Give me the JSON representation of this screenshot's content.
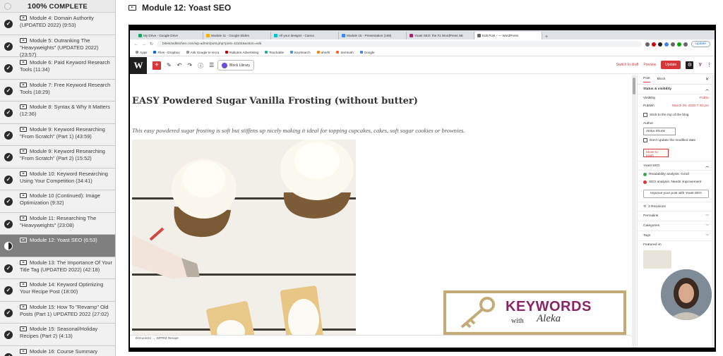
{
  "sidebar": {
    "progress_pct": "100%",
    "progress_label": "COMPLETE",
    "lessons": [
      {
        "title": "Module 4: Domain Authority (UPDATED 2022) (9:53)"
      },
      {
        "title": "Module 5: Outranking The \"Heavyweights\" (UPDATED 2022) (23:57)"
      },
      {
        "title": "Module 6: Paid Keyword Research Tools (11:34)"
      },
      {
        "title": "Module 7: Free Keyword Research Tools (18:29)"
      },
      {
        "title": "Module 8: Syntax & Why It Matters (12:36)"
      },
      {
        "title": "Module 9: Keyword Researching \"From Scratch\" (Part 1) (43:59)"
      },
      {
        "title": "Module 9: Keyword Researching \"From Scratch\" (Part 2) (15:52)"
      },
      {
        "title": "Module 10: Keyword Researching Using Your Competition (34:41)"
      },
      {
        "title": "Module 10 (Continued): Image Optimization (9:32)"
      },
      {
        "title": "Module 11: Researching The \"Heavyweights\" (23:08)"
      },
      {
        "title": "Module 12: Yoast SEO (6:53)"
      },
      {
        "title": "Module 13: The Importance Of Your Title Tag (UPDATED 2022) (42:18)"
      },
      {
        "title": "Module 14: Keyword Optimizing Your Recipe Post (18:00)"
      },
      {
        "title": "Module 15: How To \"Revamp\" Old Posts (Part 1) UPDATED 2022 (27:02)"
      },
      {
        "title": "Module 15: Seasonal/Holiday Recipes (Part 2) (4:13)"
      },
      {
        "title": "Module 16: Course Summary (UPDATED 2022) (5:40)"
      }
    ]
  },
  "header": {
    "title": "Module 12: Yoast SEO"
  },
  "browser": {
    "tabs": [
      "My Drive - Google Drive",
      "Module 11 - Google Slides",
      "All your designs - Canva",
      "Module 15 - Presentation (169)",
      "Yoast SEO: the #1 WordPress SE",
      "Edit Post ‹ — WordPress"
    ],
    "url": "bitesizedkitchen.com/wp-admin/post.php?post=11104&action=edit",
    "update_label": "Update",
    "bookmarks": [
      "Apps",
      "Files - Dropbox",
      "Ask Google to recra",
      "Rakuten Advertising",
      "Teachable",
      "KeySearch",
      "ahrefs",
      "Semrush",
      "Google"
    ]
  },
  "wp": {
    "block_library": "Block Library",
    "switch_draft": "Switch to draft",
    "preview": "Preview",
    "update": "Update",
    "post_title": "EASY Powdered Sugar Vanilla Frosting (without butter)",
    "excerpt": "This easy powdered sugar frosting is soft but stiffens up nicely making it ideal for topping cupcakes, cakes, soft sugar cookies or brownies.",
    "breadcrumb": "Document  →  WPRM Recipe",
    "logo_word": "KEYWORDS",
    "logo_with": "with",
    "logo_name": "Aleka"
  },
  "settings": {
    "tab_post": "Post",
    "tab_block": "Block",
    "status_title": "Status & visibility",
    "visibility_label": "Visibility",
    "visibility_value": "Public",
    "publish_label": "Publish",
    "publish_value": "March 29, 2020 7:35 pm",
    "stick_label": "Stick to the top of the blog",
    "author_label": "Author",
    "author_value": "Aleka Shunk",
    "dont_update_label": "Don't update the modified date",
    "trash_label": "Move to trash",
    "yoast_title": "Yoast SEO",
    "readability": "Readability analysis: Good",
    "seo_analysis": "SEO analysis: Needs improvement",
    "improve_button": "Improve your post with Yoast SEO",
    "revisions": "3 Revisions",
    "permalink": "Permalink",
    "categories": "Categories",
    "tags": "Tags",
    "featured": "Featured im",
    "colors": {
      "good": "#35a853",
      "bad": "#dc3232",
      "accent": "#d63638"
    }
  }
}
